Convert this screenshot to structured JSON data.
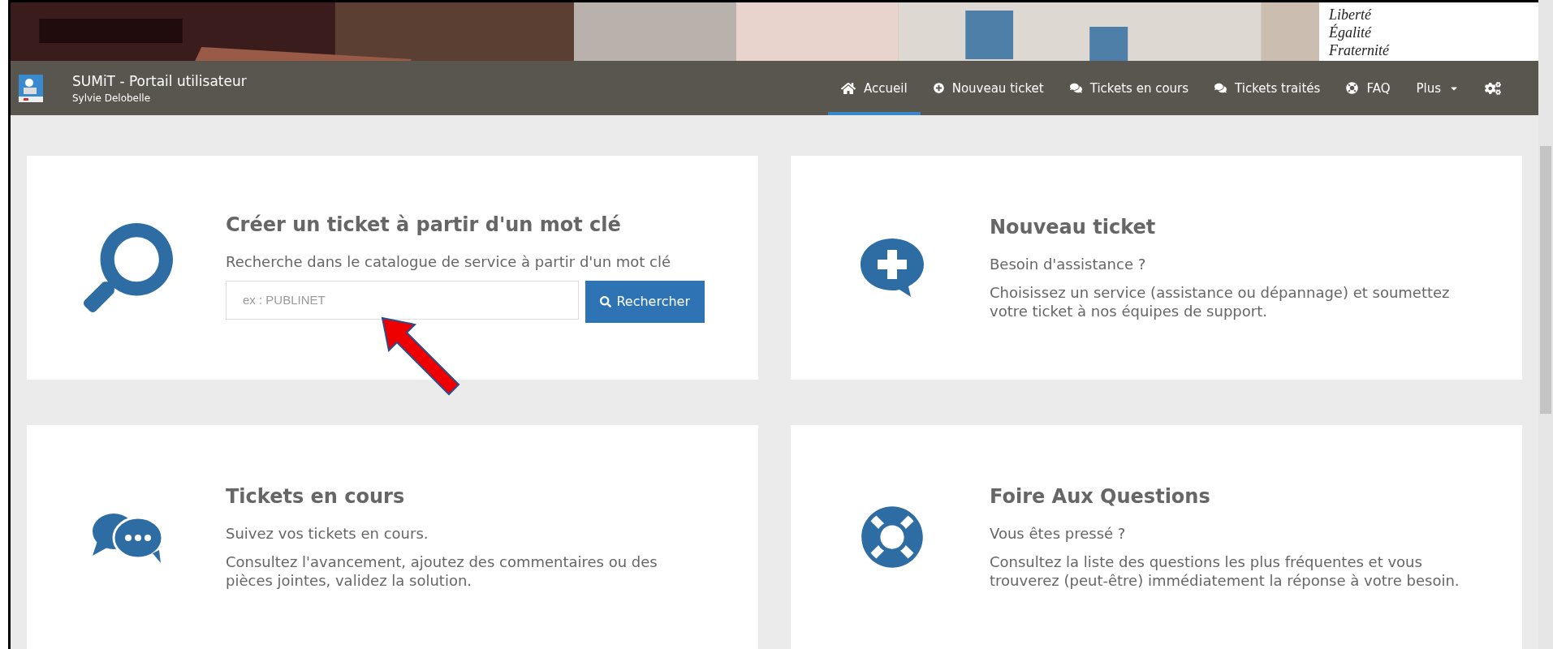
{
  "banner": {
    "kind": "picture",
    "motto": [
      "Liberté",
      "Égalité",
      "Fraternité"
    ]
  },
  "header": {
    "title": "SUMiT - Portail utilisateur",
    "user": "Sylvie Delobelle"
  },
  "nav": [
    {
      "kind": "home",
      "label": "Accueil",
      "selected": true
    },
    {
      "kind": "new",
      "label": "Nouveau ticket",
      "selected": false
    },
    {
      "kind": "open",
      "label": "Tickets en cours",
      "selected": false
    },
    {
      "kind": "done",
      "label": "Tickets traités",
      "selected": false
    },
    {
      "kind": "faq",
      "label": "FAQ",
      "selected": false
    },
    {
      "kind": "more",
      "label": "Plus",
      "selected": false
    },
    {
      "kind": "settings",
      "selected": false
    }
  ],
  "cards": [
    {
      "kind": "search",
      "title": "Créer un ticket à partir d'un mot clé",
      "lines": [
        "Recherche dans le catalogue de service à partir d'un mot clé"
      ],
      "search": {
        "placeholder": "ex : PUBLINET",
        "button": "Rechercher"
      }
    },
    {
      "kind": "new",
      "title": "Nouveau ticket",
      "lines": [
        "Besoin d'assistance ?",
        "Choisissez un service (assistance ou dépannage) et soumettez votre ticket à nos équipes de support."
      ]
    },
    {
      "kind": "open",
      "title": "Tickets en cours",
      "lines": [
        "Suivez vos tickets en cours.",
        "Consultez l'avancement, ajoutez des commentaires ou des pièces jointes, validez la solution."
      ]
    },
    {
      "kind": "faq",
      "title": "Foire Aux Questions",
      "lines": [
        "Vous êtes pressé ?",
        "Consultez la liste des questions les plus fréquentes et vous trouverez (peut-être) immédiatement la réponse à votre besoin."
      ]
    }
  ]
}
